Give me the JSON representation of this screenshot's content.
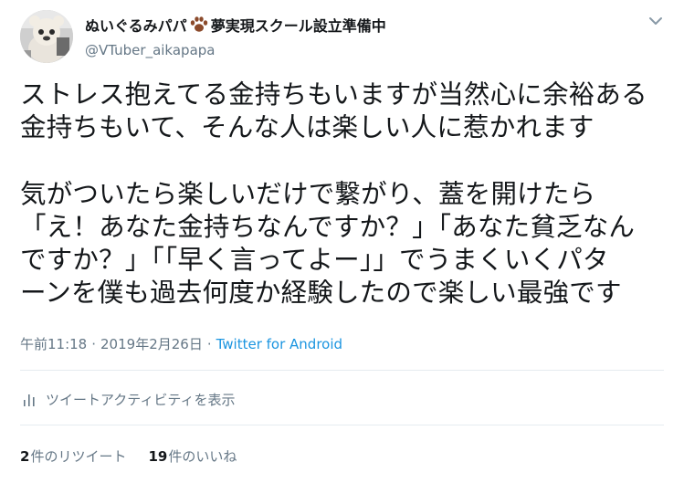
{
  "header": {
    "display_name_text": "ぬいぐるみパパ",
    "display_name_suffix": "夢実現スクール設立準備中",
    "handle": "@VTuber_aikapapa"
  },
  "tweet": {
    "lines": [
      "ストレス抱えてる金持ちもいますが当然心に余裕ある",
      "金持ちもいて、そんな人は楽しい人に惹かれます",
      "",
      "気がついたら楽しいだけで繋がり、蓋を開けたら",
      "「え！あなた金持ちなんですか？」「あなた貧乏なん",
      "ですか？」「「早く言ってよー」」でうまくいくパタ",
      "ーンを僕も過去何度か経験したので楽しい最強です"
    ]
  },
  "meta": {
    "time": "午前11:18",
    "separator": "·",
    "date": "2019年2月26日",
    "source": "Twitter for Android"
  },
  "activity": {
    "label": "ツイートアクティビティを表示"
  },
  "stats": {
    "retweets_count": "2",
    "retweets_label": "件のリツイート",
    "likes_count": "19",
    "likes_label": "件のいいね"
  },
  "icons": {
    "paw": "paw-icon",
    "chevron": "chevron-down-icon",
    "activity": "bar-chart-icon"
  },
  "colors": {
    "text": "#14171a",
    "muted": "#657786",
    "link": "#1b95e0",
    "divider": "#e6ecf0",
    "paw": "#8b4a2b"
  }
}
